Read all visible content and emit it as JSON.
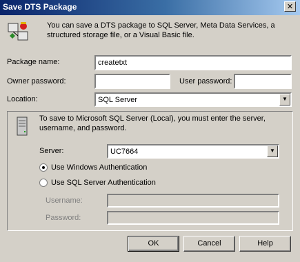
{
  "window": {
    "title": "Save DTS Package"
  },
  "intro": {
    "text": "You can save a DTS package to SQL Server, Meta Data Services, a structured storage file, or a Visual Basic file."
  },
  "package": {
    "name_label": "Package name:",
    "name_value": "createtxt",
    "owner_pw_label": "Owner password:",
    "owner_pw_value": "",
    "user_pw_label": "User password:",
    "user_pw_value": "",
    "location_label": "Location:",
    "location_value": "SQL Server"
  },
  "server_group": {
    "info_text": "To save to Microsoft SQL Server (Local), you must enter the server, username, and password.",
    "server_label": "Server:",
    "server_value": "UC7664",
    "auth_windows_label": "Use Windows Authentication",
    "auth_sql_label": "Use SQL Server Authentication",
    "selected_auth": "windows",
    "username_label": "Username:",
    "username_value": "",
    "password_label": "Password:",
    "password_value": ""
  },
  "buttons": {
    "ok": "OK",
    "cancel": "Cancel",
    "help": "Help"
  },
  "icons": {
    "title_close": "close-icon",
    "package": "dts-package-icon",
    "server": "server-icon",
    "dropdown": "chevron-down-icon"
  }
}
